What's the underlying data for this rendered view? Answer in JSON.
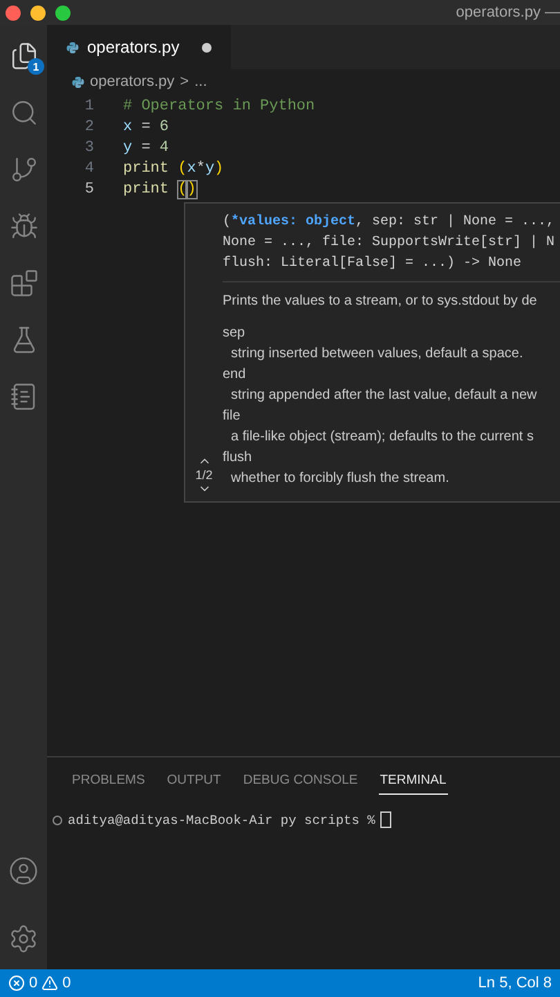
{
  "window": {
    "title": "operators.py —"
  },
  "activity_bar": {
    "items": [
      {
        "kind": "files",
        "selected": true,
        "badge": "1"
      },
      {
        "kind": "search",
        "selected": false
      },
      {
        "kind": "branch",
        "selected": false
      },
      {
        "kind": "debug",
        "selected": false
      },
      {
        "kind": "extensions",
        "selected": false
      },
      {
        "kind": "flask",
        "selected": false
      },
      {
        "kind": "notebook",
        "selected": false
      }
    ],
    "bottom_items": [
      {
        "kind": "account"
      },
      {
        "kind": "settings"
      }
    ]
  },
  "tabs": [
    {
      "label": "operators.py",
      "selected": true,
      "modified": true
    }
  ],
  "breadcrumb": {
    "file": "operators.py",
    "separator": ">",
    "more": "..."
  },
  "editor": {
    "lines": [
      {
        "number": "1",
        "current": false,
        "tokens": [
          {
            "kind": "comment",
            "text": "# Operators in Python"
          }
        ]
      },
      {
        "number": "2",
        "current": false,
        "tokens": [
          {
            "kind": "variable",
            "text": "x"
          },
          {
            "kind": "plain",
            "text": " = "
          },
          {
            "kind": "number",
            "text": "6"
          }
        ]
      },
      {
        "number": "3",
        "current": false,
        "tokens": [
          {
            "kind": "variable",
            "text": "y"
          },
          {
            "kind": "plain",
            "text": " = "
          },
          {
            "kind": "number",
            "text": "4"
          }
        ]
      },
      {
        "number": "4",
        "current": false,
        "tokens": [
          {
            "kind": "function",
            "text": "print "
          },
          {
            "kind": "bracket",
            "text": "("
          },
          {
            "kind": "variable",
            "text": "x"
          },
          {
            "kind": "plain",
            "text": "*"
          },
          {
            "kind": "variable",
            "text": "y"
          },
          {
            "kind": "bracket",
            "text": ")"
          }
        ]
      },
      {
        "number": "5",
        "current": true,
        "tokens": [
          {
            "kind": "function",
            "text": "print "
          },
          {
            "kind": "matched",
            "text": "("
          },
          {
            "kind": "matched",
            "text": ")"
          }
        ]
      }
    ]
  },
  "hover": {
    "pager": "1/2",
    "signature": [
      [
        {
          "kind": "plain",
          "text": "("
        },
        {
          "kind": "active",
          "text": "*values: object"
        },
        {
          "kind": "plain",
          "text": ", sep: str | None = ...,"
        }
      ],
      [
        {
          "kind": "plain",
          "text": "None = ..., file: SupportsWrite[str] | N"
        }
      ],
      [
        {
          "kind": "plain",
          "text": "flush: Literal[False] = ...) -> None"
        }
      ]
    ],
    "docs": [
      {
        "kind": "text",
        "text": "Prints the values to a stream, or to sys.stdout by de"
      },
      {
        "kind": "term",
        "text": "sep"
      },
      {
        "kind": "desc",
        "text": "string inserted between values, default a space."
      },
      {
        "kind": "term",
        "text": "end"
      },
      {
        "kind": "desc",
        "text": "string appended after the last value, default a new"
      },
      {
        "kind": "term",
        "text": "file"
      },
      {
        "kind": "desc",
        "text": "a file-like object (stream); defaults to the current s"
      },
      {
        "kind": "term",
        "text": "flush"
      },
      {
        "kind": "desc",
        "text": "whether to forcibly flush the stream."
      }
    ]
  },
  "panel": {
    "tabs": [
      {
        "label": "PROBLEMS",
        "selected": false
      },
      {
        "label": "OUTPUT",
        "selected": false
      },
      {
        "label": "DEBUG CONSOLE",
        "selected": false
      },
      {
        "label": "TERMINAL",
        "selected": true
      }
    ],
    "terminal": {
      "prompt": "aditya@adityas-MacBook-Air py scripts %"
    }
  },
  "status_bar": {
    "errors": "0",
    "warnings": "0",
    "position": "Ln 5, Col 8"
  }
}
